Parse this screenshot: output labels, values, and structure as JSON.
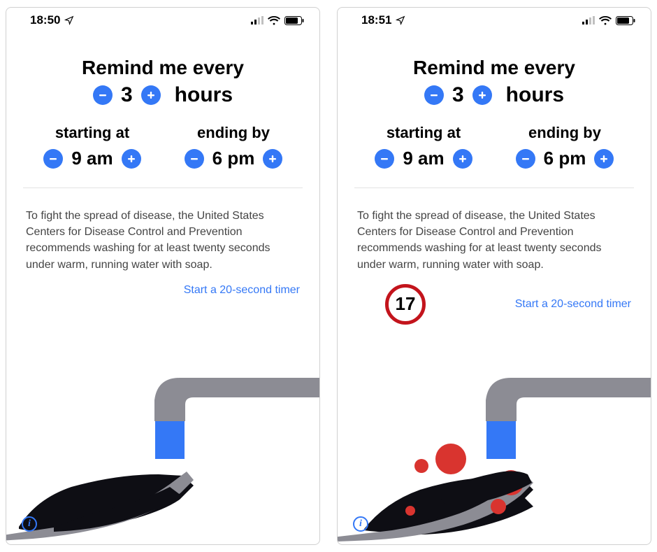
{
  "left": {
    "status": {
      "time": "18:50"
    },
    "settings": {
      "title": "Remind me every",
      "freq_value": "3",
      "freq_unit": "hours",
      "start_label": "starting at",
      "start_value": "9 am",
      "end_label": "ending by",
      "end_value": "6 pm"
    },
    "info_text": "To fight the spread of disease, the United States Centers for Disease Control and Prevention recommends washing for at least twenty seconds under warm, running water with soap.",
    "start_link": "Start a 20-second timer"
  },
  "right": {
    "status": {
      "time": "18:51"
    },
    "settings": {
      "title": "Remind me every",
      "freq_value": "3",
      "freq_unit": "hours",
      "start_label": "starting at",
      "start_value": "9 am",
      "end_label": "ending by",
      "end_value": "6 pm"
    },
    "info_text": "To fight the spread of disease, the United States Centers for Disease Control and Prevention recommends washing for at least twenty seconds under warm, running water with soap.",
    "timer_value": "17",
    "start_link": "Start a 20-second timer"
  },
  "colors": {
    "accent": "#3478f6",
    "highlight_ring": "#c3141c",
    "bubble": "#d9342f"
  }
}
